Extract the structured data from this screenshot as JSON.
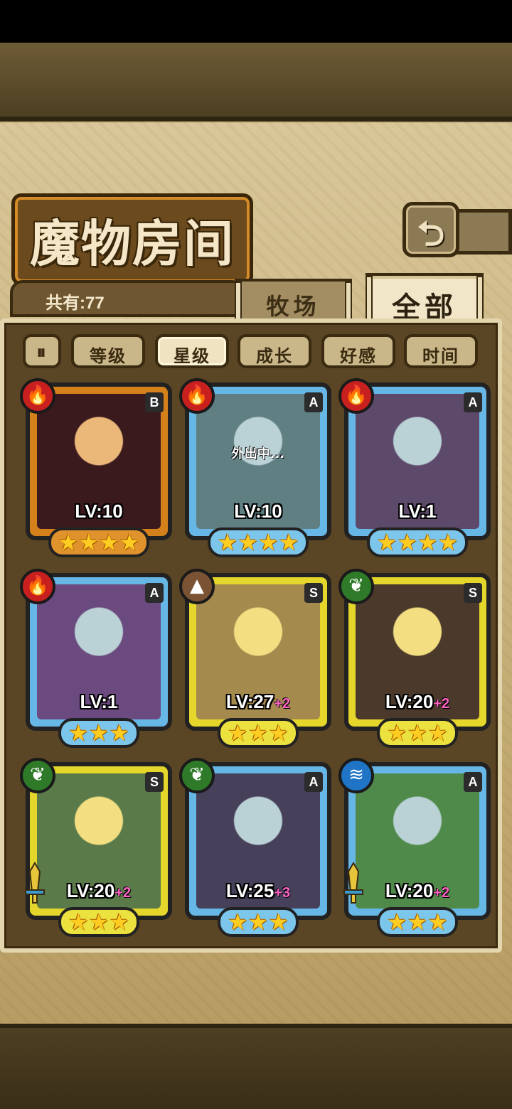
{
  "screen": {
    "title": "魔物房间",
    "back_icon": "return-arrow-icon",
    "count_label": "共有:77"
  },
  "tabs": [
    {
      "label": "牧场",
      "active": false
    },
    {
      "label": "全部",
      "active": true
    }
  ],
  "sort_buttons": [
    {
      "label": "等级",
      "active": false
    },
    {
      "label": "星级",
      "active": true
    },
    {
      "label": "成长",
      "active": false
    },
    {
      "label": "好感",
      "active": false
    },
    {
      "label": "时间",
      "active": false
    }
  ],
  "sort_toggle_icon": "pause-sort-icon",
  "monsters": [
    {
      "element": "fire",
      "rank": "B",
      "level": "LV:10",
      "bonus": "",
      "stars": 4,
      "status": "",
      "weapon": false,
      "art": "#3b1a1e"
    },
    {
      "element": "fire",
      "rank": "A",
      "level": "LV:10",
      "bonus": "",
      "stars": 4,
      "status": "外出中...",
      "weapon": false,
      "art": "#5f7f83"
    },
    {
      "element": "fire",
      "rank": "A",
      "level": "LV:1",
      "bonus": "",
      "stars": 4,
      "status": "",
      "weapon": false,
      "art": "#5d4a6b"
    },
    {
      "element": "fire",
      "rank": "A",
      "level": "LV:1",
      "bonus": "",
      "stars": 3,
      "status": "",
      "weapon": false,
      "art": "#6b4a80"
    },
    {
      "element": "earth",
      "rank": "S",
      "level": "LV:27",
      "bonus": "+2",
      "stars": 3,
      "status": "",
      "weapon": false,
      "art": "#a58a4e"
    },
    {
      "element": "wood",
      "rank": "S",
      "level": "LV:20",
      "bonus": "+2",
      "stars": 3,
      "status": "",
      "weapon": false,
      "art": "#4b3a2c"
    },
    {
      "element": "wood",
      "rank": "S",
      "level": "LV:20",
      "bonus": "+2",
      "stars": 3,
      "status": "",
      "weapon": true,
      "art": "#5a7a4a"
    },
    {
      "element": "wood",
      "rank": "A",
      "level": "LV:25",
      "bonus": "+3",
      "stars": 3,
      "status": "",
      "weapon": false,
      "art": "#46405a"
    },
    {
      "element": "water",
      "rank": "A",
      "level": "LV:20",
      "bonus": "+2",
      "stars": 3,
      "status": "",
      "weapon": true,
      "art": "#4f8a4a"
    }
  ],
  "colors": {
    "fire": "#c8201f",
    "earth": "#7a5334",
    "wood": "#2f7a28",
    "water": "#1f74c6",
    "star": "#ffcc21",
    "bonus": "#ff62c6"
  }
}
